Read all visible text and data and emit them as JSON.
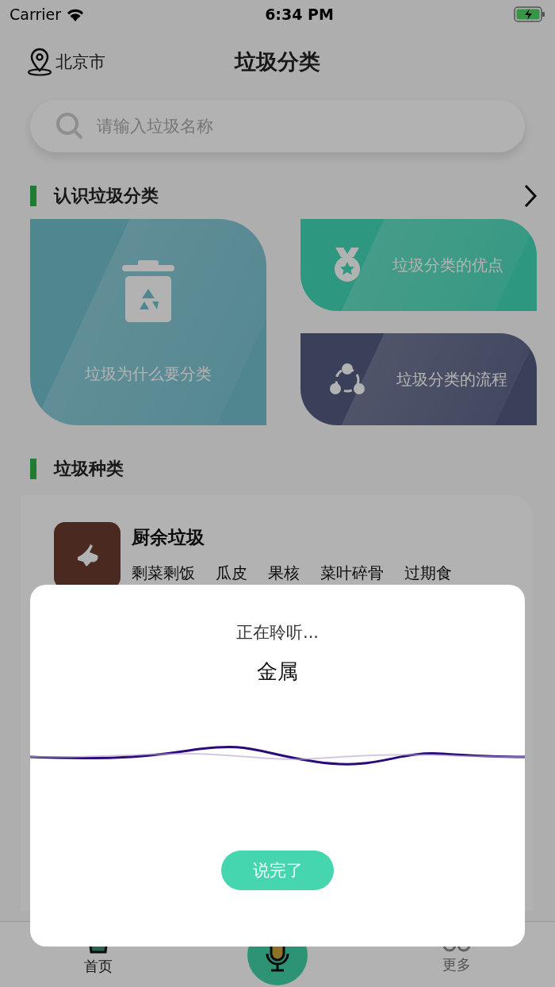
{
  "status_bar": {
    "carrier": "Carrier",
    "time": "6:34 PM"
  },
  "header": {
    "location": "北京市",
    "title": "垃圾分类"
  },
  "search": {
    "placeholder": "请输入垃圾名称"
  },
  "learn_section": {
    "title": "认识垃圾分类",
    "cards": [
      {
        "kind": "bin",
        "label": "垃圾为什么要分类"
      },
      {
        "kind": "medal",
        "label": "垃圾分类的优点"
      },
      {
        "kind": "cycle",
        "label": "垃圾分类的流程"
      }
    ]
  },
  "types_section": {
    "title": "垃圾种类",
    "items": [
      {
        "name": "厨余垃圾",
        "examples": [
          "剩菜剩饭",
          "瓜皮",
          "果核",
          "菜叶碎骨",
          "过期食"
        ]
      }
    ]
  },
  "tab_bar": [
    {
      "kind": "home",
      "label": "首页",
      "selected": true
    },
    {
      "kind": "mic"
    },
    {
      "kind": "more",
      "label": "更多",
      "selected": false
    }
  ],
  "dialog": {
    "status": "正在聆听...",
    "transcript": "金属",
    "button": "说完了"
  }
}
